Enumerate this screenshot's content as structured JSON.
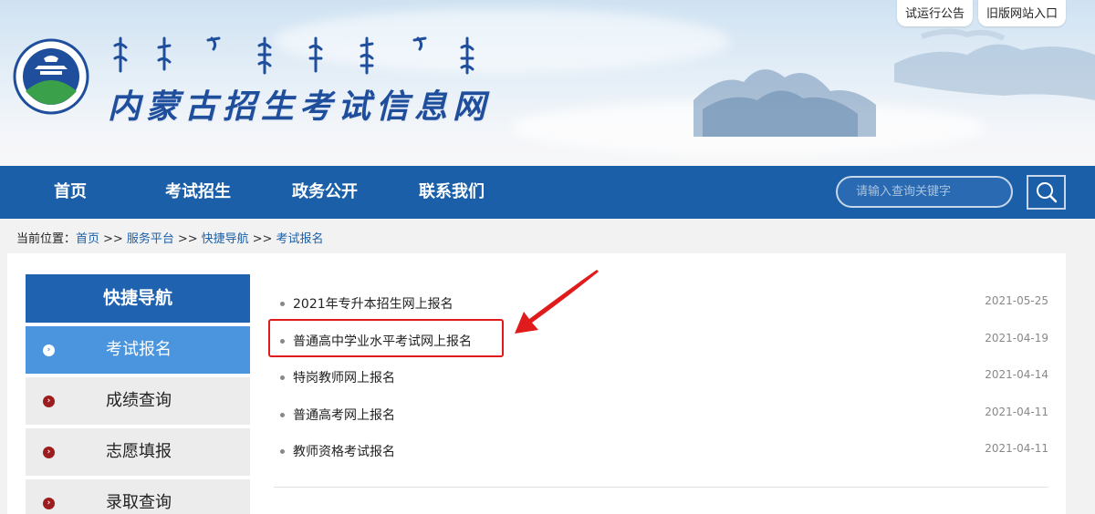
{
  "header": {
    "site_title": "内蒙古招生考试信息网",
    "top_links": [
      "试运行公告",
      "旧版网站入口"
    ]
  },
  "nav": {
    "items": [
      "首页",
      "考试招生",
      "政务公开",
      "联系我们"
    ],
    "search_placeholder": "请输入查询关键字"
  },
  "breadcrumb": {
    "prefix": "当前位置：",
    "items": [
      "首页",
      "服务平台",
      "快捷导航",
      "考试报名"
    ],
    "separator": ">>"
  },
  "sidebar": {
    "header": "快捷导航",
    "items": [
      {
        "label": "考试报名",
        "active": true
      },
      {
        "label": "成绩查询",
        "active": false
      },
      {
        "label": "志愿填报",
        "active": false
      },
      {
        "label": "录取查询",
        "active": false
      }
    ]
  },
  "list": {
    "items": [
      {
        "title": "2021年专升本招生网上报名",
        "date": "2021-05-25"
      },
      {
        "title": "普通高中学业水平考试网上报名",
        "date": "2021-04-19"
      },
      {
        "title": "特岗教师网上报名",
        "date": "2021-04-14"
      },
      {
        "title": "普通高考网上报名",
        "date": "2021-04-11"
      },
      {
        "title": "教师资格考试报名",
        "date": "2021-04-11"
      }
    ]
  },
  "colors": {
    "nav_blue": "#1b5fa8",
    "sidebar_active": "#4a95dd",
    "annotation_red": "#e01b1b"
  }
}
